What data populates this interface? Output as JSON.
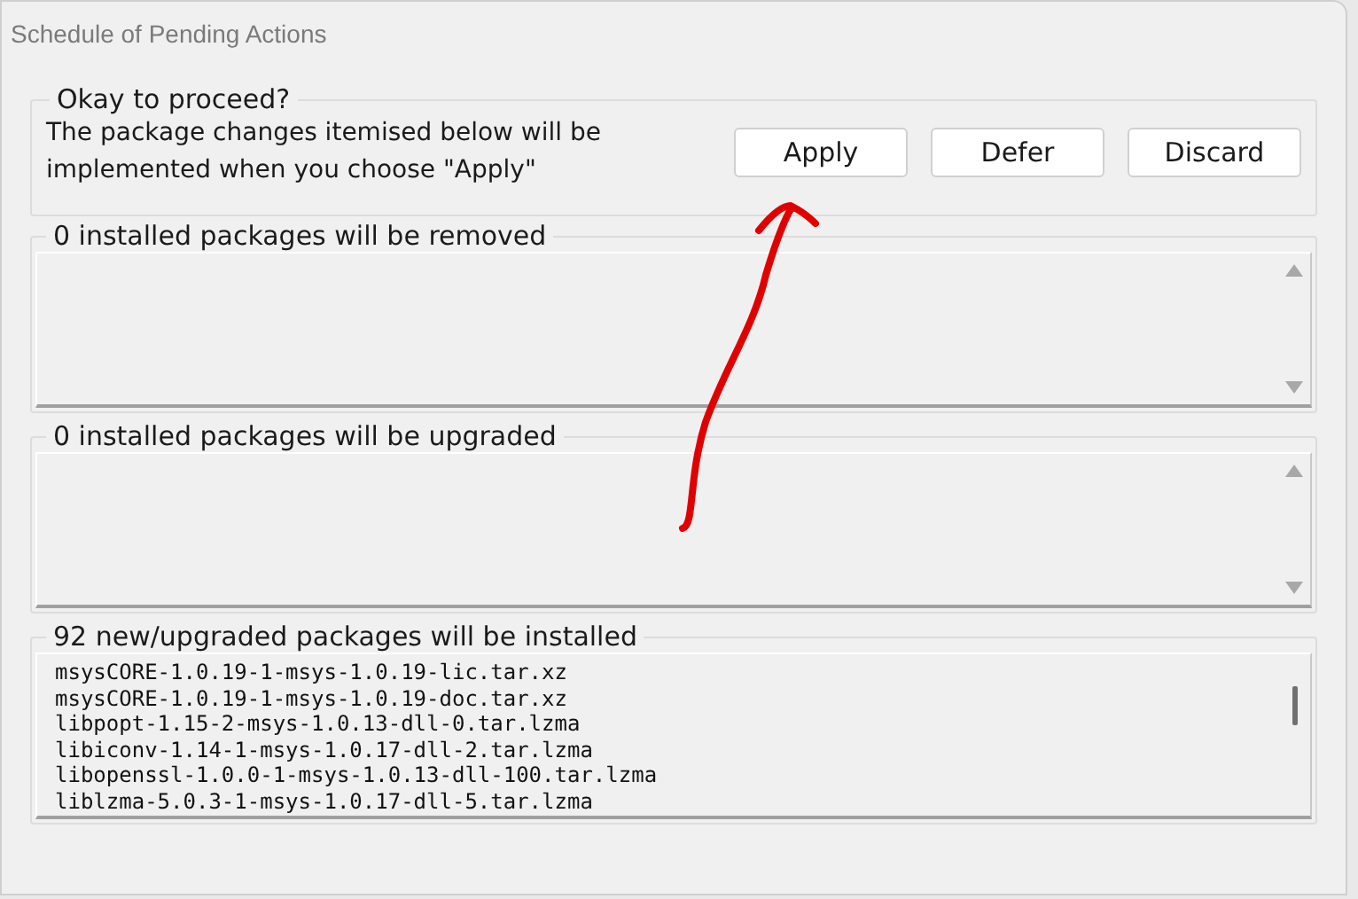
{
  "window": {
    "title": "Schedule of Pending Actions"
  },
  "confirm": {
    "legend": "Okay to proceed?",
    "message": "The package changes itemised below will be implemented when you choose \"Apply\"",
    "buttons": [
      "Apply",
      "Defer",
      "Discard"
    ]
  },
  "lists": [
    {
      "legend": "0 installed packages will be removed"
    },
    {
      "legend": "0 installed packages will be upgraded"
    },
    {
      "legend": "92 new/upgraded packages will be installed",
      "items": [
        "msysCORE-1.0.19-1-msys-1.0.19-lic.tar.xz",
        "msysCORE-1.0.19-1-msys-1.0.19-doc.tar.xz",
        "libpopt-1.15-2-msys-1.0.13-dll-0.tar.lzma",
        "libiconv-1.14-1-msys-1.0.17-dll-2.tar.lzma",
        "libopenssl-1.0.0-1-msys-1.0.13-dll-100.tar.lzma",
        "liblzma-5.0.3-1-msys-1.0.17-dll-5.tar.lzma"
      ]
    }
  ]
}
